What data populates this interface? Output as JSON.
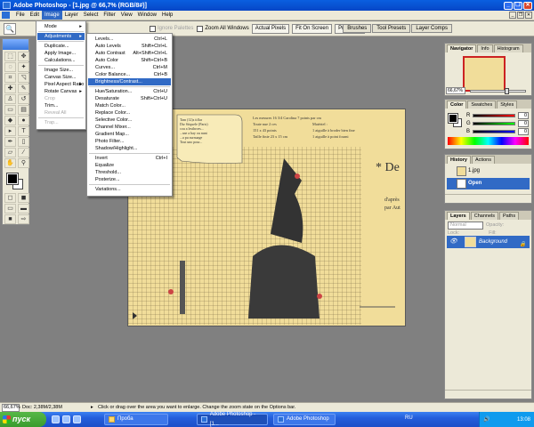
{
  "window": {
    "title": "Adobe Photoshop - [1.jpg @ 66,7% (RGB/8#)]"
  },
  "menubar": [
    "File",
    "Edit",
    "Image",
    "Layer",
    "Select",
    "Filter",
    "View",
    "Window",
    "Help"
  ],
  "options": {
    "resize_windows": "Resize Windows To Fit",
    "ignore_palettes": "Ignore Palettes",
    "zoom_all": "Zoom All Windows",
    "actual_pixels": "Actual Pixels",
    "fit_on_screen": "Fit On Screen",
    "print_size": "Print Size",
    "tabs": [
      "Brushes",
      "Tool Presets",
      "Layer Comps"
    ]
  },
  "image_menu": {
    "mode": "Mode",
    "adjustments": "Adjustments",
    "duplicate": "Duplicate...",
    "apply_image": "Apply Image...",
    "calculations": "Calculations...",
    "image_size": "Image Size...",
    "canvas_size": "Canvas Size...",
    "pixel_aspect": "Pixel Aspect Ratio",
    "rotate_canvas": "Rotate Canvas",
    "crop": "Crop",
    "trim": "Trim...",
    "reveal_all": "Reveal All",
    "trap": "Trap..."
  },
  "adjust_menu": {
    "levels": "Levels...",
    "levels_sc": "Ctrl+L",
    "auto_levels": "Auto Levels",
    "auto_levels_sc": "Shift+Ctrl+L",
    "auto_contrast": "Auto Contrast",
    "auto_contrast_sc": "Alt+Shift+Ctrl+L",
    "auto_color": "Auto Color",
    "auto_color_sc": "Shift+Ctrl+B",
    "curves": "Curves...",
    "curves_sc": "Ctrl+M",
    "color_balance": "Color Balance...",
    "color_balance_sc": "Ctrl+B",
    "brightness": "Brightness/Contrast...",
    "hue_sat": "Hue/Saturation...",
    "hue_sat_sc": "Ctrl+U",
    "desaturate": "Desaturate",
    "desaturate_sc": "Shift+Ctrl+U",
    "match_color": "Match Color...",
    "replace_color": "Replace Color...",
    "selective_color": "Selective Color...",
    "channel_mixer": "Channel Mixer...",
    "gradient_map": "Gradient Map...",
    "photo_filter": "Photo Filter...",
    "shadow_highlight": "Shadow/Highlight...",
    "invert": "Invert",
    "invert_sc": "Ctrl+I",
    "equalize": "Equalize",
    "threshold": "Threshold...",
    "posterize": "Posterize...",
    "variations": "Variations..."
  },
  "document": {
    "text_left": [
      "Tam (12)s tiflar",
      "Diz Stiquele (Paris)",
      "cou a lesthroes...",
      "...sne a bay ou nant",
      "...a pu surnuage",
      "Tout uno pour..."
    ],
    "text_mid": [
      "Les mesures 16 3/4 Carolina 7 points par cm",
      "Toute nue 2 ces",
      "151 x 43 points",
      "Taille finie 23 x 15 cm"
    ],
    "text_right": [
      "Matériel :",
      "1 aiguille à broder bien fine",
      "1 aiguille à point fourni"
    ],
    "big_letters": "* De",
    "right_lines": [
      "d'après",
      "par Aut"
    ]
  },
  "navigator": {
    "tabs": [
      "Navigator",
      "Info",
      "Histogram"
    ],
    "zoom": "66,67%"
  },
  "color": {
    "tabs": [
      "Color",
      "Swatches",
      "Styles"
    ],
    "r_label": "R",
    "g_label": "G",
    "b_label": "B",
    "r": "0",
    "g": "0",
    "b": "0"
  },
  "history": {
    "tabs": [
      "History",
      "Actions"
    ],
    "snapshot": "1.jpg",
    "step": "Open"
  },
  "layers": {
    "tabs": [
      "Layers",
      "Channels",
      "Paths"
    ],
    "blend": "Normal",
    "opacity_label": "Opacity:",
    "lock_label": "Lock:",
    "fill_label": "Fill:",
    "layer_name": "Background"
  },
  "status": {
    "zoom": "66,67%",
    "doc": "Doc: 2,38M/2,38M",
    "message": "Click or drag over the area you want to enlarge. Change the zoom state on the Options bar."
  },
  "taskbar": {
    "start": "пуск",
    "tasks": [
      "Проба",
      "Adobe Photoshop - [1...",
      "Adobe Photoshop"
    ],
    "lang": "RU",
    "clock": "13:08"
  }
}
